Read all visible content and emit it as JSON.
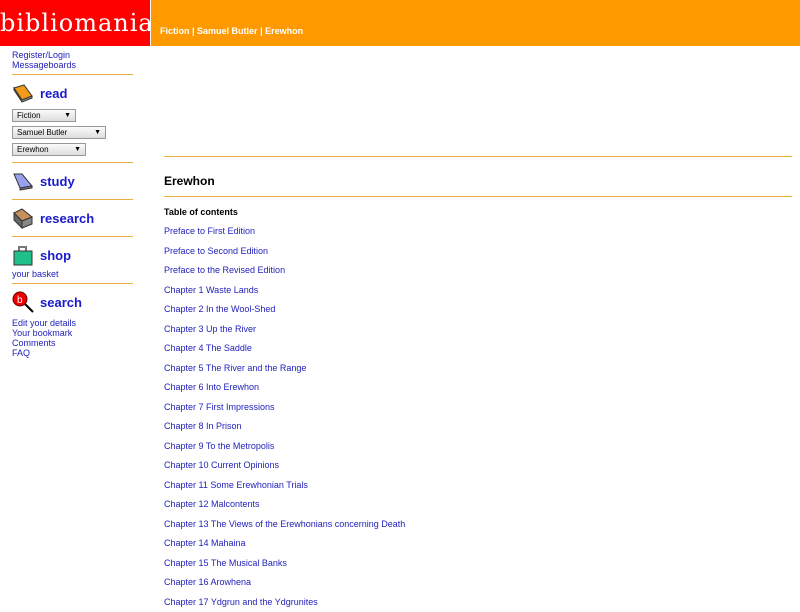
{
  "logo": "bibliomania",
  "breadcrumb": [
    "Fiction",
    "Samuel Butler",
    "Erewhon"
  ],
  "sidebar": {
    "top_links": [
      "Register/Login",
      "Messageboards"
    ],
    "read": {
      "label": "read",
      "selects": [
        "Fiction",
        "Samuel Butler",
        "Erewhon"
      ]
    },
    "study": "study",
    "research": "research",
    "shop": {
      "label": "shop",
      "link": "your basket"
    },
    "search": {
      "label": "search",
      "links": [
        "Edit your details",
        "Your bookmark",
        "Comments",
        "FAQ"
      ]
    }
  },
  "main": {
    "title": "Erewhon",
    "toc_label": "Table of contents",
    "chapters": [
      "Preface to First Edition",
      "Preface to Second Edition",
      "Preface to the Revised Edition",
      "Chapter 1 Waste Lands",
      "Chapter 2 In the Wool-Shed",
      "Chapter 3 Up the River",
      "Chapter 4 The Saddle",
      "Chapter 5 The River and the Range",
      "Chapter 6 Into Erewhon",
      "Chapter 7 First Impressions",
      "Chapter 8 In Prison",
      "Chapter 9 To the Metropolis",
      "Chapter 10 Current Opinions",
      "Chapter 11 Some Erewhonian Trials",
      "Chapter 12 Malcontents",
      "Chapter 13 The Views of the Erewhonians concerning Death",
      "Chapter 14 Mahaina",
      "Chapter 15 The Musical Banks",
      "Chapter 16 Arowhena",
      "Chapter 17 Ydgrun and the Ydgrunites"
    ]
  }
}
